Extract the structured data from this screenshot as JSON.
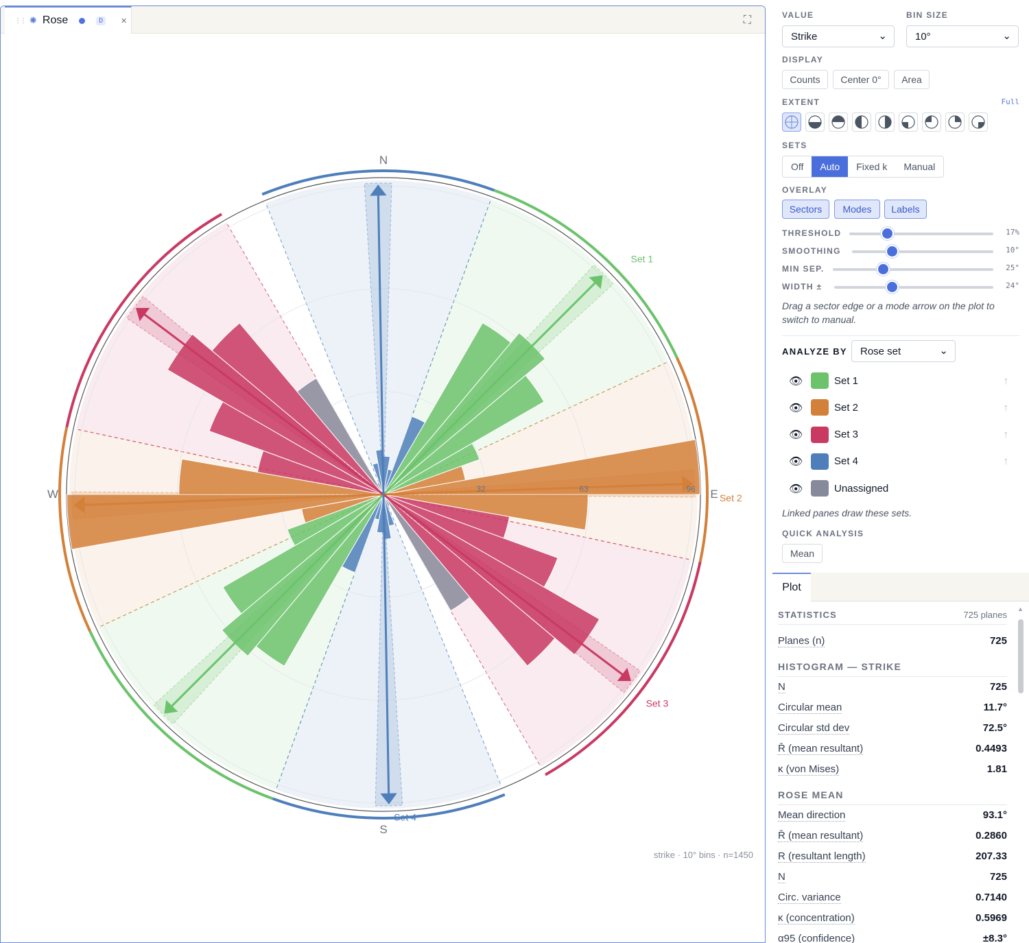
{
  "tab": {
    "title": "Rose",
    "badge": "D",
    "close": "×",
    "expand": "⛶"
  },
  "plot": {
    "compass": {
      "N": "N",
      "E": "E",
      "S": "S",
      "W": "W"
    },
    "ring_labels": [
      "32",
      "63",
      "96"
    ],
    "footer": "strike · 10° bins · n=1450",
    "colors": {
      "set1": "#6cc36c",
      "set2": "#d3803a",
      "set3": "#c93a63",
      "set4": "#4e7fba",
      "unassigned": "#878a9a"
    },
    "sets": [
      {
        "name": "Set 1",
        "label": "Set 1",
        "mean_deg": 45,
        "sector": [
          20,
          65
        ],
        "color": "#6cc36c"
      },
      {
        "name": "Set 2",
        "label": "Set 2",
        "mean_deg": 88,
        "sector": [
          65,
          102
        ],
        "color": "#d3803a"
      },
      {
        "name": "Set 3",
        "label": "Set 3",
        "mean_deg": 127,
        "sector": [
          102,
          150
        ],
        "color": "#c93a63"
      },
      {
        "name": "Set 4",
        "label": "Set 4",
        "mean_deg": 179,
        "sector": [
          158,
          200
        ],
        "color": "#4e7fba"
      }
    ],
    "bins": [
      {
        "start": 0,
        "value": 12,
        "set": 4
      },
      {
        "start": 10,
        "value": 8,
        "set": 4
      },
      {
        "start": 20,
        "value": 26,
        "set": 4
      },
      {
        "start": 30,
        "value": 62,
        "set": 1
      },
      {
        "start": 40,
        "value": 66,
        "set": 1
      },
      {
        "start": 50,
        "value": 58,
        "set": 1
      },
      {
        "start": 60,
        "value": 32,
        "set": 1
      },
      {
        "start": 70,
        "value": 26,
        "set": 2
      },
      {
        "start": 80,
        "value": 99,
        "set": 2
      },
      {
        "start": 90,
        "value": 64,
        "set": 2
      },
      {
        "start": 100,
        "value": 40,
        "set": 3
      },
      {
        "start": 110,
        "value": 58,
        "set": 3
      },
      {
        "start": 120,
        "value": 78,
        "set": 3
      },
      {
        "start": 130,
        "value": 70,
        "set": 3
      },
      {
        "start": 140,
        "value": 42,
        "set": 0
      },
      {
        "start": 150,
        "value": 4,
        "set": 0
      },
      {
        "start": 160,
        "value": 10,
        "set": 4
      },
      {
        "start": 170,
        "value": 14,
        "set": 4
      }
    ],
    "ring_max": 96
  },
  "panel": {
    "value_label": "VALUE",
    "value": "Strike",
    "bin_label": "BIN SIZE",
    "bin": "10°",
    "display_label": "DISPLAY",
    "display_buttons": [
      "Counts",
      "Center 0°",
      "Area"
    ],
    "extent_label": "EXTENT",
    "extent_mode": "Full",
    "sets_label": "SETS",
    "sets_modes": [
      "Off",
      "Auto",
      "Fixed k",
      "Manual"
    ],
    "overlay_label": "OVERLAY",
    "overlay_buttons": [
      "Sectors",
      "Modes",
      "Labels"
    ],
    "sliders": [
      {
        "name": "THRESHOLD",
        "value": "17%",
        "fraction": 0.26
      },
      {
        "name": "SMOOTHING",
        "value": "10°",
        "fraction": 0.28
      },
      {
        "name": "MIN SEP.",
        "value": "25°",
        "fraction": 0.31
      },
      {
        "name": "WIDTH ±",
        "value": "24°",
        "fraction": 0.36
      }
    ],
    "hint": "Drag a sector edge or a mode arrow on the plot to switch to manual.",
    "analyze_label": "ANALYZE BY",
    "analyze_value": "Rose set",
    "set_rows": [
      {
        "name": "Set 1",
        "color": "#6cc36c"
      },
      {
        "name": "Set 2",
        "color": "#d3803a"
      },
      {
        "name": "Set 3",
        "color": "#c93a63"
      },
      {
        "name": "Set 4",
        "color": "#4e7fba"
      },
      {
        "name": "Unassigned",
        "color": "#878a9a"
      }
    ],
    "linked_note": "Linked panes draw these sets.",
    "quick_label": "QUICK ANALYSIS",
    "quick_button": "Mean"
  },
  "stats": {
    "tab": "Plot",
    "head": "STATISTICS",
    "planes": "725 planes",
    "planes_row": {
      "k": "Planes (n)",
      "v": "725"
    },
    "hist_head": "HISTOGRAM — STRIKE",
    "hist": [
      {
        "k": "N",
        "v": "725"
      },
      {
        "k": "Circular mean",
        "v": "11.7°"
      },
      {
        "k": "Circular std dev",
        "v": "72.5°"
      },
      {
        "k": "R̄ (mean resultant)",
        "v": "0.4493"
      },
      {
        "k": "κ (von Mises)",
        "v": "1.81"
      }
    ],
    "rose_head": "ROSE MEAN",
    "rose": [
      {
        "k": "Mean direction",
        "v": "93.1°"
      },
      {
        "k": "R̄ (mean resultant)",
        "v": "0.2860"
      },
      {
        "k": "R (resultant length)",
        "v": "207.33"
      },
      {
        "k": "N",
        "v": "725"
      },
      {
        "k": "Circ. variance",
        "v": "0.7140"
      },
      {
        "k": "κ (concentration)",
        "v": "0.5969"
      },
      {
        "k": "α95 (confidence)",
        "v": "±8.3°"
      }
    ]
  }
}
